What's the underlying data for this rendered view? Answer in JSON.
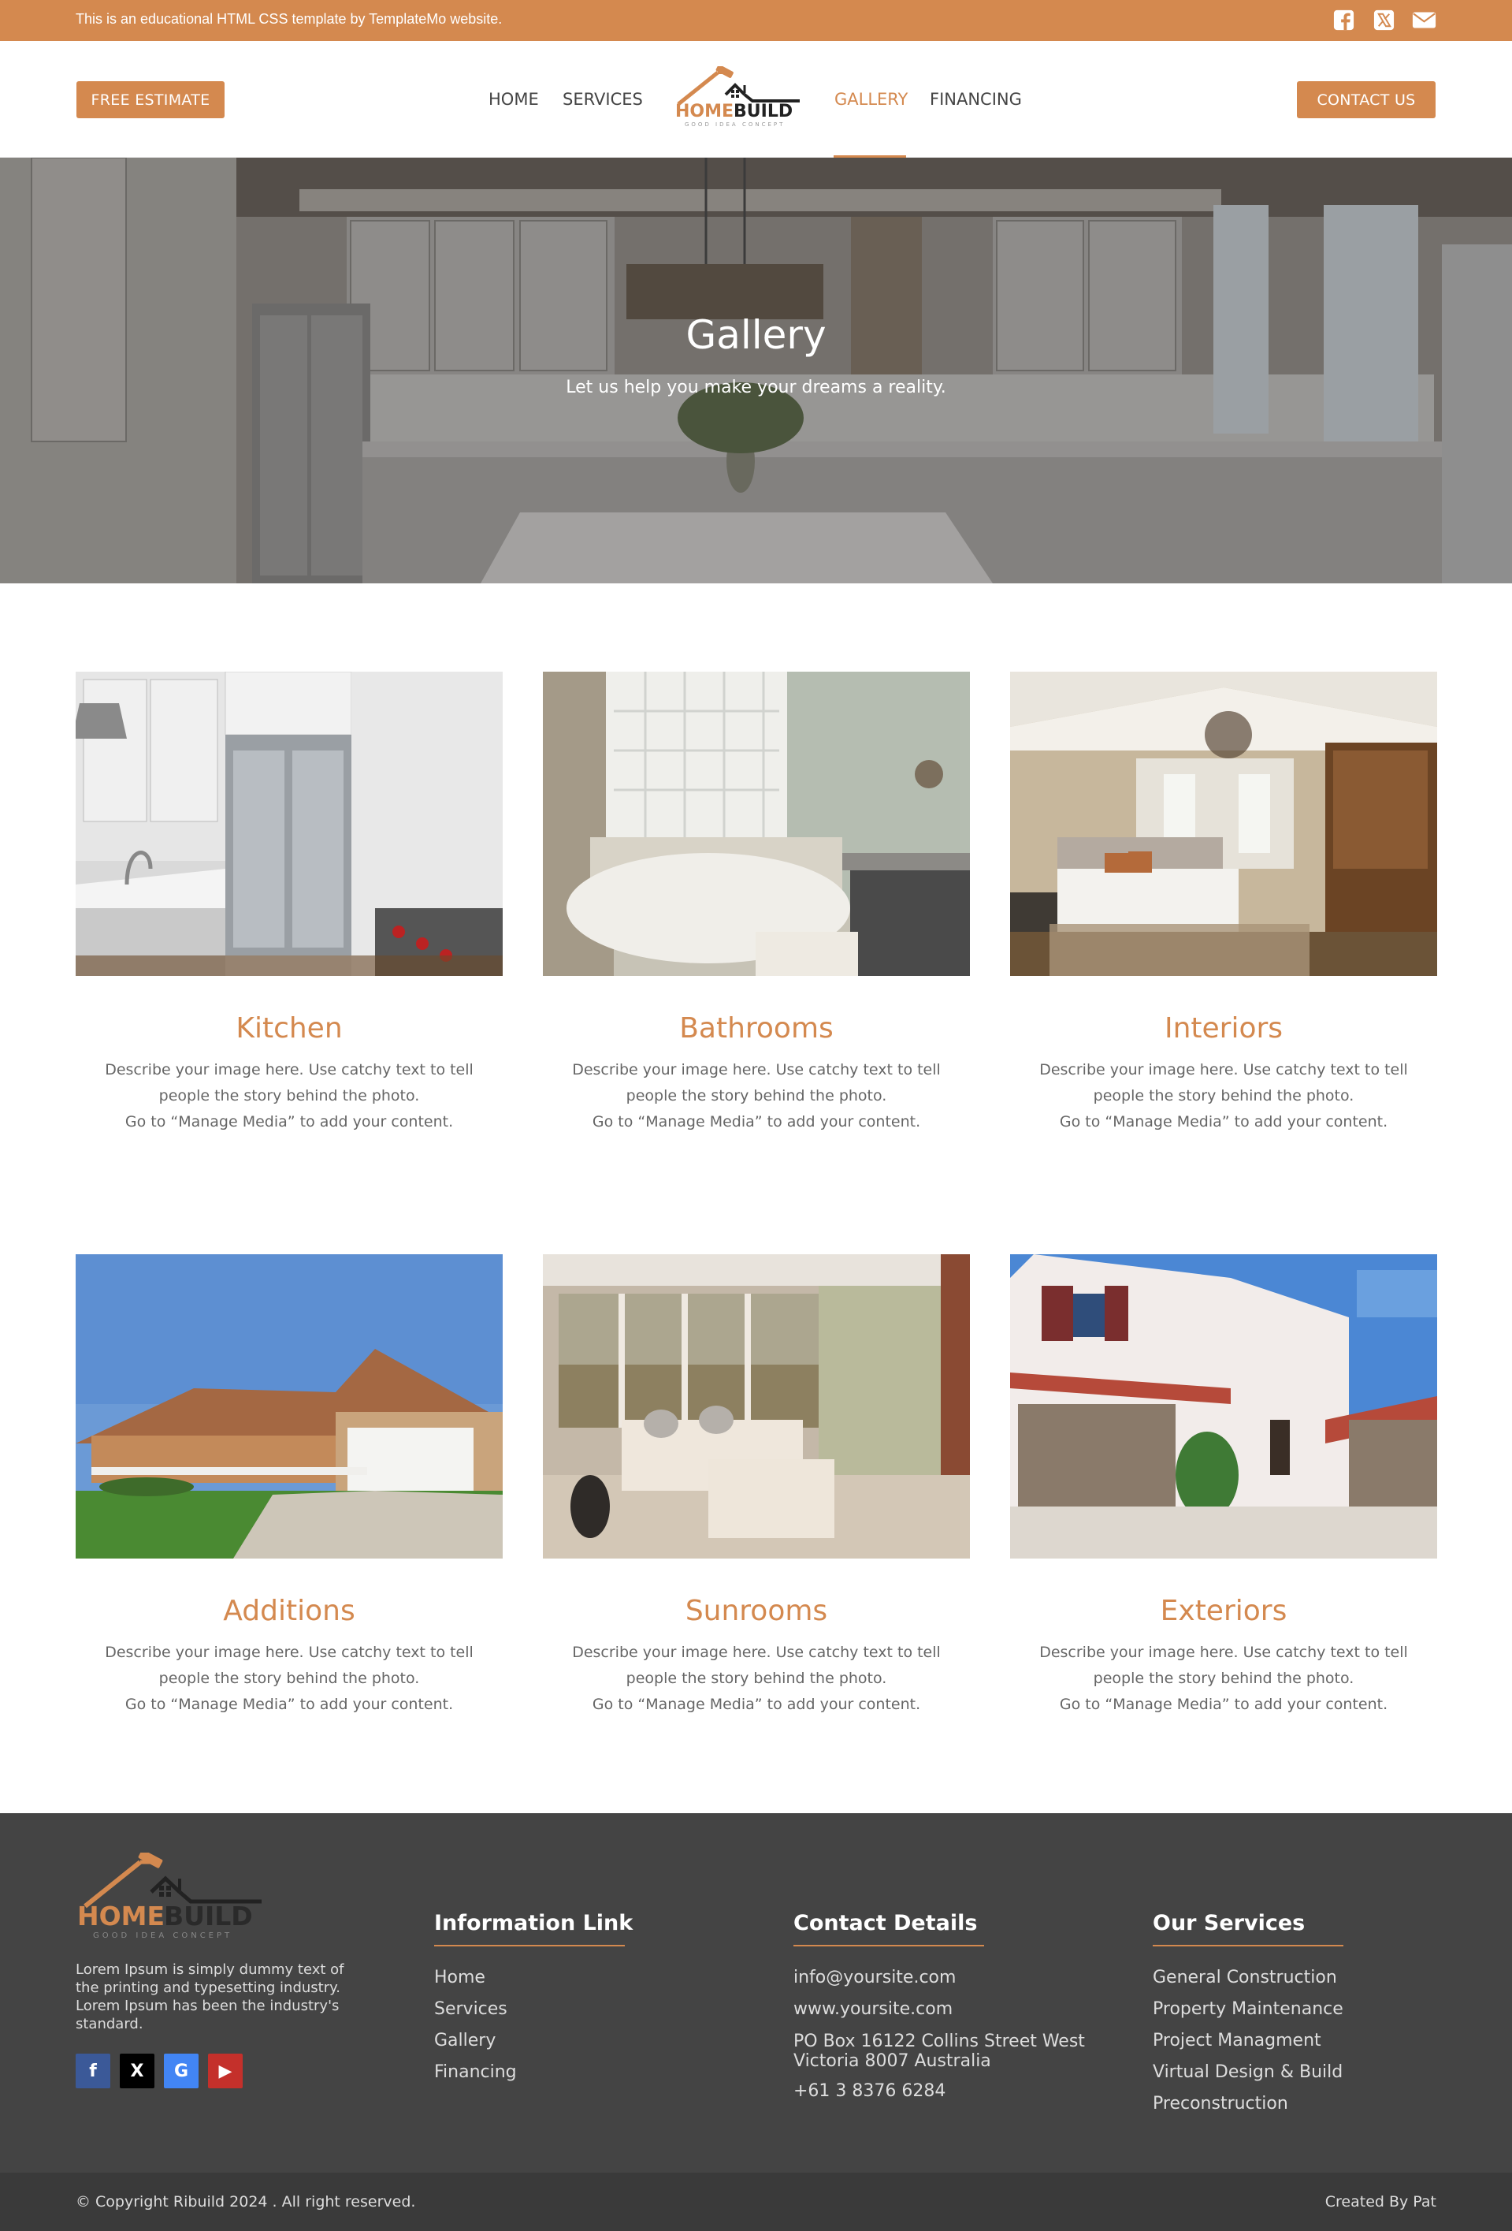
{
  "topbar": {
    "text": "This is an educational HTML CSS template by TemplateMo website.",
    "icons": [
      "facebook-square-icon",
      "x-twitter-icon",
      "envelope-icon"
    ]
  },
  "header": {
    "free_estimate": "FREE ESTIMATE",
    "contact_us": "CONTACT US",
    "nav": {
      "home": "HOME",
      "services": "SERVICES",
      "gallery": "GALLERY",
      "financing": "FINANCING"
    },
    "logo": {
      "brand_home": "HOME",
      "brand_build": "BUILD",
      "tagline": "GOOD IDEA CONCEPT"
    }
  },
  "hero": {
    "title": "Gallery",
    "subtitle": "Let us help you make your dreams a reality."
  },
  "gallery": {
    "description_line1": "Describe your image here. Use catchy text to tell people the story behind the photo.",
    "description_line2": "Go to “Manage Media” to add your content.",
    "items": [
      {
        "title": "Kitchen"
      },
      {
        "title": "Bathrooms"
      },
      {
        "title": "Interiors"
      },
      {
        "title": "Additions"
      },
      {
        "title": "Sunrooms"
      },
      {
        "title": "Exteriors"
      }
    ]
  },
  "footer": {
    "about": "Lorem Ipsum is simply dummy text of the printing and typesetting industry. Lorem Ipsum has been the industry's standard.",
    "socials": [
      "f",
      "X",
      "G",
      "▶"
    ],
    "info": {
      "heading": "Information Link",
      "links": [
        "Home",
        "Services",
        "Gallery",
        "Financing"
      ]
    },
    "contact": {
      "heading": "Contact Details",
      "email": "info@yoursite.com",
      "website": "www.yoursite.com",
      "address_line1": "PO Box 16122 Collins Street West",
      "address_line2": "Victoria 8007 Australia",
      "phone": "+61 3 8376 6284"
    },
    "services": {
      "heading": "Our Services",
      "links": [
        "General Construction",
        "Property Maintenance",
        "Project Managment",
        "Virtual Design & Build",
        "Preconstruction"
      ]
    },
    "copyright": "© Copyright Ribuild 2024 . All right reserved.",
    "credit": "Created By Pat"
  },
  "colors": {
    "accent": "#d4894f",
    "footer_bg": "#444444",
    "copyright_bg": "#3a3a3a"
  }
}
